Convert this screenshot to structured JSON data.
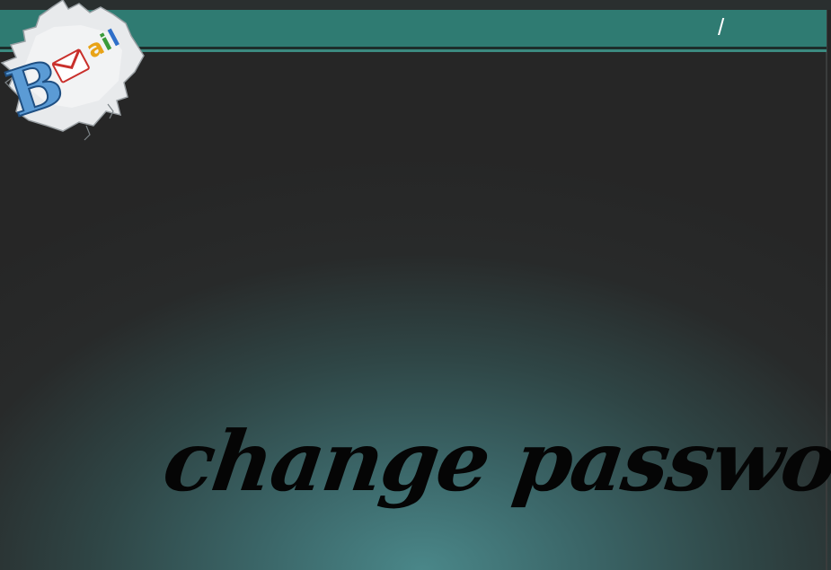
{
  "header": {
    "slash_text": "/"
  },
  "logo": {
    "initial": "B",
    "wordmark": "mail",
    "icon": "envelope-icon"
  },
  "main": {
    "title": "change password"
  },
  "colors": {
    "header_teal": "#2f7b72",
    "background_dark": "#262626",
    "glow_teal": "#4a8789",
    "title_text": "#050505"
  }
}
